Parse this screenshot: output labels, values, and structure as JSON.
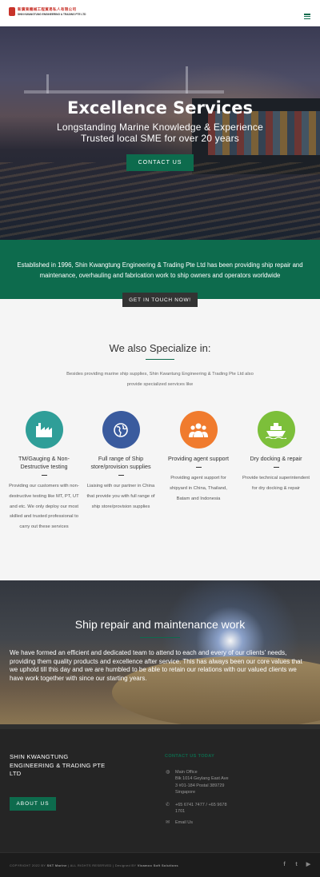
{
  "header": {
    "logo_chinese": "新廣東機械工程貿易私人有限公司",
    "logo_english": "SHIN KWANGTUNG ENGINEERING & TRADING PTE LTD",
    "menu_icon": "hamburger-menu-icon"
  },
  "hero": {
    "title": "Excellence Services",
    "subtitle_1": "Longstanding Marine Knowledge & Experience",
    "subtitle_2": "Trusted local SME for over 20 years",
    "cta": "CONTACT US"
  },
  "intro": {
    "text": "Established in 1996, Shin Kwangtung Engineering & Trading Pte Ltd has been providing ship repair and maintenance, overhauling and fabrication work to ship owners and operators worldwide",
    "cta": "GET IN TOUCH NOW!"
  },
  "specialize": {
    "title": "We also Specialize in:",
    "intro": "Besides providing marine ship supplies, Shin Kwantung Engineering & Trading Pte Ltd also provide specialized services like",
    "services": [
      {
        "title": "TM/Gauging & Non-Destructive testing",
        "description": "Providing our customers with non-destructive testing like MT, PT, UT and etc. We only deploy our most skilled and trusted professional to carry out these services",
        "icon": "factory-icon",
        "color": "#2f9e98"
      },
      {
        "title": "Full range of Ship store/provision supplies",
        "description": "Liaising with our partner in China that provide you with full range of ship store/provision supplies",
        "icon": "globe-icon",
        "color": "#3a5b9e"
      },
      {
        "title": "Providing agent support",
        "description": "Providing agent support for shipyard in China, Thailand, Batam and Indonesia",
        "icon": "users-group-icon",
        "color": "#f07b2e"
      },
      {
        "title": "Dry docking & repair",
        "description": "Provide technical superintendent for dry docking & repair",
        "icon": "ship-icon",
        "color": "#7cbf3a"
      }
    ]
  },
  "repair": {
    "title": "Ship repair and maintenance work",
    "text": "We have formed an efficient and dedicated team to attend to each and every of our clients' needs, providing them quality products and excellence after service. This has always been our core values that we uphold till this day and we are humbled to be able to retain our relations with our valued clients we have work together with since our starting years."
  },
  "footer": {
    "company": "SHIN KWANGTUNG ENGINEERING & TRADING PTE LTD",
    "about_button": "ABOUT US",
    "contact_heading": "CONTACT US TODAY",
    "office_label": "Main Office",
    "address_1": "Blk 1014 Geylang East Ave",
    "address_2": "3 #01-184 Postal 389729",
    "address_3": "Singapore",
    "phone_1": "+65 6741 7477 / +65 9678",
    "phone_2": "1701",
    "email": "Email Us",
    "copyright_prefix": "COPYRIGHT 2022 BY",
    "copyright_brand": "SKT Marine",
    "copyright_mid": "| ALL RIGHTS RESERVED | Designed BY",
    "copyright_designer": "Vicamco Soft Solutions",
    "social_facebook": "f",
    "social_twitter": "t",
    "social_youtube": "▶"
  }
}
